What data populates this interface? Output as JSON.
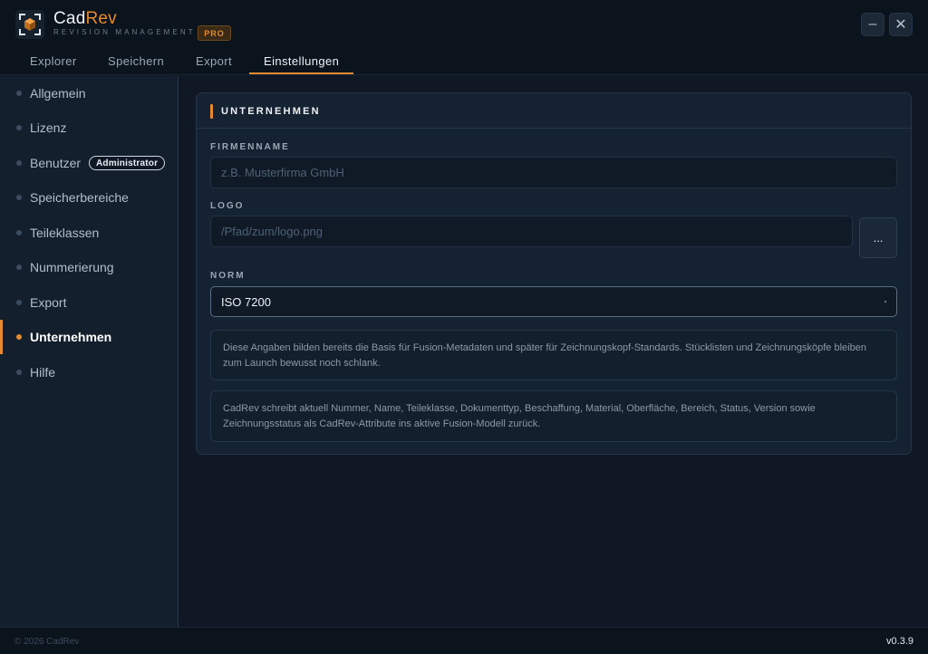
{
  "app": {
    "name_primary": "Cad",
    "name_accent": "Rev",
    "subtitle": "REVISION MANAGEMENT",
    "badge": "PRO",
    "minimize_icon": "minimize-icon",
    "close_icon": "close-icon",
    "minimize_glyph": "–",
    "close_glyph": "✕"
  },
  "tabs": [
    {
      "label": "Explorer"
    },
    {
      "label": "Speichern"
    },
    {
      "label": "Export"
    },
    {
      "label": "Einstellungen",
      "active": true
    }
  ],
  "sidebar": {
    "items": [
      {
        "label": "Allgemein"
      },
      {
        "label": "Lizenz"
      },
      {
        "label": "Benutzer",
        "badge": "Administrator"
      },
      {
        "label": "Speicherbereiche"
      },
      {
        "label": "Teileklassen"
      },
      {
        "label": "Nummerierung"
      },
      {
        "label": "Export"
      },
      {
        "label": "Unternehmen",
        "active": true
      },
      {
        "label": "Hilfe"
      }
    ]
  },
  "section": {
    "title": "UNTERNEHMEN",
    "company": {
      "label": "FIRMENNAME",
      "placeholder": "z.B. Musterfirma GmbH",
      "value": ""
    },
    "logo": {
      "label": "LOGO",
      "placeholder": "/Pfad/zum/logo.png",
      "value": "",
      "browse_label": "..."
    },
    "norm": {
      "label": "NORM",
      "value": "ISO 7200"
    },
    "info_1": "Diese Angaben bilden bereits die Basis für Fusion-Metadaten und später für Zeichnungskopf-Standards. Stücklisten und Zeichnungsköpfe bleiben zum Launch bewusst noch schlank.",
    "info_2": "CadRev schreibt aktuell Nummer, Name, Teileklasse, Dokumenttyp, Beschaffung, Material, Oberfläche, Bereich, Status, Version sowie Zeichnungsstatus als CadRev-Attribute ins aktive Fusion-Modell zurück."
  },
  "footer": {
    "copyright": "© 2026 CadRev",
    "version": "v0.3.9"
  },
  "colors": {
    "accent": "#e58a2e",
    "background": "#0f1824",
    "sidebar": "#131f2c",
    "card": "#152231"
  }
}
